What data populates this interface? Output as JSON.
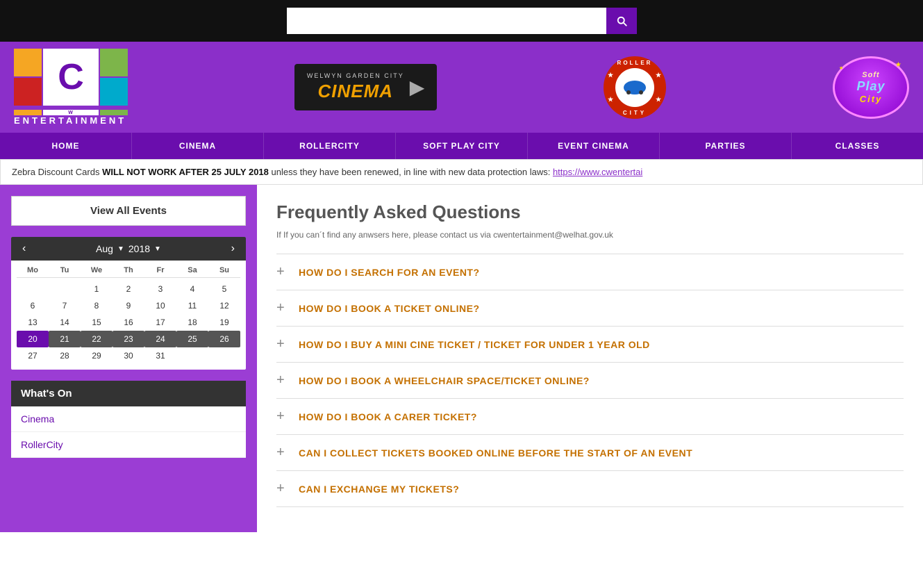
{
  "topbar": {
    "search_placeholder": ""
  },
  "header": {
    "cw_label": "ENTERTAINMENT",
    "cinema_sub": "WELWYN GARDEN CITY",
    "cinema_main": "CINEMA",
    "rollercity_text_top": "ROLLER",
    "rollercity_text_bottom": "CITY",
    "softplay_soft": "Soft",
    "softplay_play": "Play",
    "softplay_city": "City"
  },
  "nav": {
    "items": [
      {
        "label": "HOME",
        "id": "home"
      },
      {
        "label": "CINEMA",
        "id": "cinema"
      },
      {
        "label": "ROLLERCITY",
        "id": "rollercity"
      },
      {
        "label": "SOFT PLAY CITY",
        "id": "softplaycity"
      },
      {
        "label": "EVENT CINEMA",
        "id": "eventcinema"
      },
      {
        "label": "PARTIES",
        "id": "parties"
      },
      {
        "label": "CLASSES",
        "id": "classes"
      }
    ]
  },
  "notice": {
    "text_before": "Zebra Discount Cards ",
    "text_bold": "WILL NOT WORK AFTER 25 JULY 2018",
    "text_after": " unless they have been renewed, in line with new data protection laws: ",
    "link_text": "https://www.cwentertai",
    "link_url": "#"
  },
  "sidebar": {
    "view_all_label": "View All Events",
    "calendar": {
      "month": "Aug",
      "year": "2018",
      "day_headers": [
        "Mo",
        "Tu",
        "We",
        "Th",
        "Fr",
        "Sa",
        "Su"
      ],
      "weeks": [
        [
          "",
          "",
          "1",
          "2",
          "3",
          "4",
          "5"
        ],
        [
          "6",
          "7",
          "8",
          "9",
          "10",
          "11",
          "12"
        ],
        [
          "13",
          "14",
          "15",
          "16",
          "17",
          "18",
          "19"
        ],
        [
          "20",
          "21",
          "22",
          "23",
          "24",
          "25",
          "26"
        ],
        [
          "27",
          "28",
          "29",
          "30",
          "31",
          "",
          ""
        ]
      ],
      "today": "20",
      "current_week": [
        "21",
        "22",
        "23",
        "24",
        "25",
        "26"
      ]
    },
    "whats_on": {
      "title": "What's On",
      "items": [
        "Cinema",
        "RollerCity"
      ]
    }
  },
  "faq": {
    "title": "Frequently Asked Questions",
    "subtitle": "If If you can´t find any anwsers here, please contact us via cwentertainment@welhat.gov.uk",
    "items": [
      {
        "question": "HOW DO I SEARCH FOR AN EVENT?"
      },
      {
        "question": "HOW DO I BOOK A TICKET ONLINE?"
      },
      {
        "question": "HOW DO I BUY A MINI CINE TICKET / TICKET FOR UNDER 1 YEAR OLD"
      },
      {
        "question": "HOW DO I BOOK A WHEELCHAIR SPACE/TICKET ONLINE?"
      },
      {
        "question": "HOW DO I BOOK A CARER TICKET?"
      },
      {
        "question": "CAN I COLLECT TICKETS BOOKED ONLINE BEFORE THE START OF AN EVENT"
      },
      {
        "question": "CAN I EXCHANGE MY TICKETS?"
      }
    ]
  }
}
